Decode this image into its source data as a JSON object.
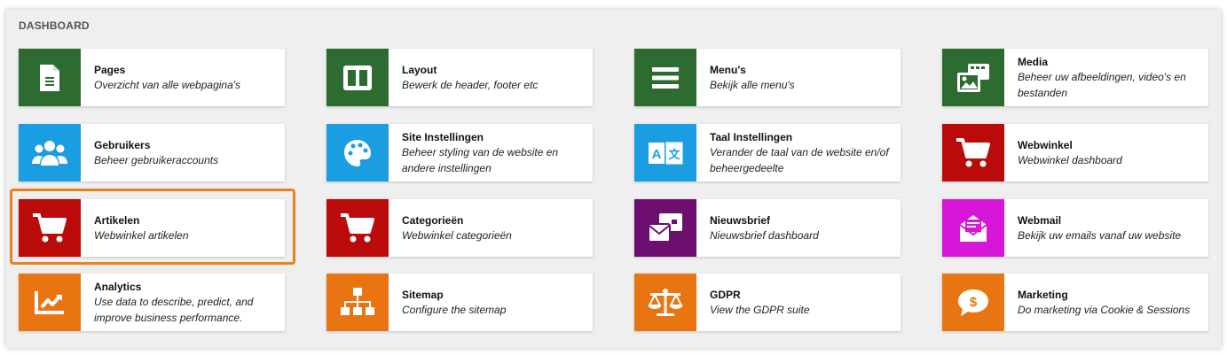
{
  "dashboard": {
    "title": "DASHBOARD",
    "tiles": [
      {
        "title": "Pages",
        "desc": "Overzicht van alle webpagina's",
        "color": "#2e6b30",
        "icon": "document-icon"
      },
      {
        "title": "Layout",
        "desc": "Bewerk de header, footer etc",
        "color": "#2e6b30",
        "icon": "layout-icon"
      },
      {
        "title": "Menu's",
        "desc": "Bekijk alle menu's",
        "color": "#2e6b30",
        "icon": "menu-icon"
      },
      {
        "title": "Media",
        "desc": "Beheer uw afbeeldingen, video's en bestanden",
        "color": "#2e6b30",
        "icon": "media-icon"
      },
      {
        "title": "Gebruikers",
        "desc": "Beheer gebruikeraccounts",
        "color": "#1b9de2",
        "icon": "users-icon"
      },
      {
        "title": "Site Instellingen",
        "desc": "Beheer styling van de website en andere instellingen",
        "color": "#1b9de2",
        "icon": "palette-icon"
      },
      {
        "title": "Taal Instellingen",
        "desc": "Verander de taal van de website en/of beheergedeelte",
        "color": "#1b9de2",
        "icon": "language-icon"
      },
      {
        "title": "Webwinkel",
        "desc": "Webwinkel dashboard",
        "color": "#bb0a0a",
        "icon": "cart-icon"
      },
      {
        "title": "Artikelen",
        "desc": "Webwinkel artikelen",
        "color": "#bb0a0a",
        "icon": "cart-icon"
      },
      {
        "title": "Categorieën",
        "desc": "Webwinkel categorieën",
        "color": "#bb0a0a",
        "icon": "cart-icon"
      },
      {
        "title": "Nieuwsbrief",
        "desc": "Nieuwsbrief dashboard",
        "color": "#6d0f6e",
        "icon": "newsletter-icon"
      },
      {
        "title": "Webmail",
        "desc": "Bekijk uw emails vanaf uw website",
        "color": "#d816d8",
        "icon": "mail-icon"
      },
      {
        "title": "Analytics",
        "desc": "Use data to describe, predict, and improve business performance.",
        "color": "#e87511",
        "icon": "chart-icon"
      },
      {
        "title": "Sitemap",
        "desc": "Configure the sitemap",
        "color": "#e87511",
        "icon": "sitemap-icon"
      },
      {
        "title": "GDPR",
        "desc": "View the GDPR suite",
        "color": "#e87511",
        "icon": "scale-icon"
      },
      {
        "title": "Marketing",
        "desc": "Do marketing via Cookie & Sessions",
        "color": "#e87511",
        "icon": "dollar-chat-icon"
      }
    ]
  },
  "highlight_color": "#e8821e"
}
